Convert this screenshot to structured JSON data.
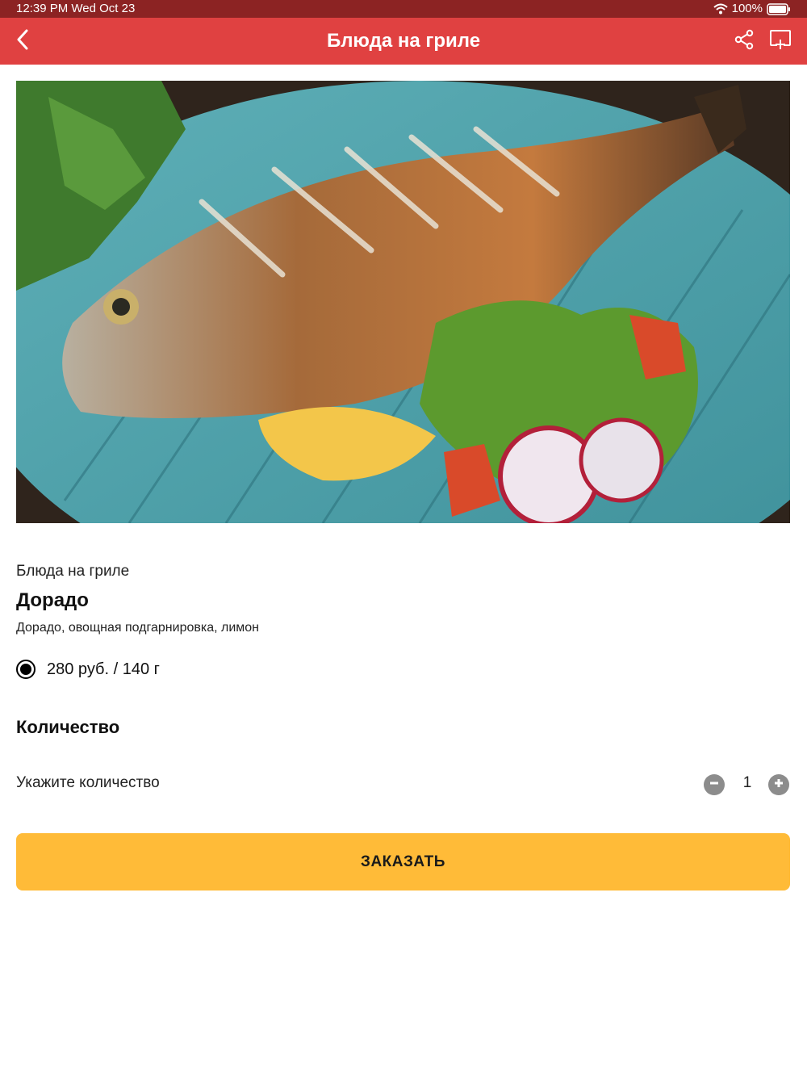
{
  "status_bar": {
    "time": "12:39 PM  Wed Oct 23",
    "battery": "100%"
  },
  "nav": {
    "title": "Блюда на гриле",
    "back_icon": "chevron-left-icon",
    "share_icon": "share-icon",
    "cast_icon": "cast-add-icon"
  },
  "hero": {
    "image": "grilled-dorado-photo"
  },
  "product": {
    "category": "Блюда на гриле",
    "name": "Дорадо",
    "description": "Дорадо, овощная подгарнировка, лимон",
    "option_label": "280 руб. / 140 г",
    "option_selected": true
  },
  "quantity": {
    "heading": "Количество",
    "label": "Укажите количество",
    "value": "1"
  },
  "order": {
    "label": "ЗАКАЗАТЬ"
  },
  "colors": {
    "status_bar": "#8c2323",
    "nav_bar": "#e04141",
    "order_button": "#ffbb38",
    "stepper": "#8c8c8c"
  }
}
